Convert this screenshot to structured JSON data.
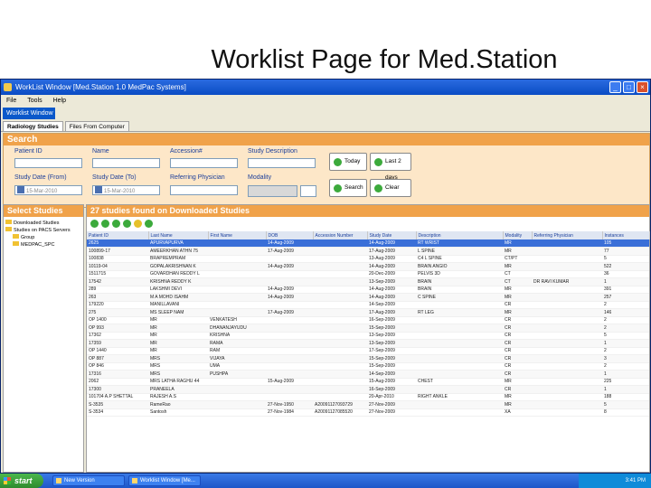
{
  "slide": {
    "title": "Worklist Page for Med.Station"
  },
  "window": {
    "title": "WorkList Window [Med.Station 1.0 MedPac Systems]",
    "menu": [
      "File",
      "Tools",
      "Help"
    ],
    "main_tab": "Worklist Window",
    "subtabs": [
      "Radiology Studies",
      "Files From Computer"
    ]
  },
  "search": {
    "header": "Search",
    "patient_id_label": "Patient ID",
    "name_label": "Name",
    "accession_label": "Accession#",
    "study_desc_label": "Study Description",
    "study_date_from_label": "Study Date (From)",
    "study_date_to_label": "Study Date (To)",
    "ref_physician_label": "Referring Physician",
    "modality_label": "Modality",
    "date_from_value": "15-Mar-2010",
    "date_to_value": "15-Mar-2010",
    "today_label": "Today",
    "last2days_label": "Last 2 days",
    "search_label": "Search",
    "clear_label": "Clear"
  },
  "left": {
    "header": "Select Studies",
    "tree": [
      "Downloaded Studies",
      "Studies on PACS Servers",
      "Group",
      "MEDPAC_SPC"
    ]
  },
  "right": {
    "header": "27 studies found on Downloaded Studies",
    "columns": [
      "Patient ID",
      "Last Name",
      "First Name",
      "DOB",
      "Accession Number",
      "Study Date",
      "Description",
      "Modality",
      "Referring Physician",
      "Instances"
    ],
    "rows": [
      [
        "2625",
        "APURVAPURVA",
        "",
        "14-Aug-2009",
        "",
        "14-Aug-2009",
        "RT WRIST",
        "MR",
        "",
        "105"
      ],
      [
        "100899-17",
        "AMEERKHAN ATHN 75",
        "",
        "17-Aug-2009",
        "",
        "17-Aug-2009",
        "L SPINE",
        "MR",
        "",
        "77"
      ],
      [
        "100838",
        "BRAPREMPRAM",
        "",
        "",
        "",
        "13-Aug-2009",
        "C4 L SPINE",
        "CT/PT",
        "",
        "5"
      ],
      [
        "10119-04",
        "GOPALAKRISHNAN K",
        "",
        "14-Aug-2009",
        "",
        "14-Aug-2009",
        "BRAIN ANGIO",
        "MR",
        "",
        "522"
      ],
      [
        "1511715",
        "GOVARDHAN REDDY L",
        "",
        "",
        "",
        "20-Dec-2009",
        "PELVIS 3D",
        "CT",
        "",
        "36"
      ],
      [
        "17542",
        "KRISHNA REDDY K",
        "",
        "",
        "",
        "13-Sep-2009",
        "BRAIN",
        "CT",
        "DR RAVI KUMAR",
        "1"
      ],
      [
        "289",
        "LAKSHMI DEVI",
        "",
        "14-Aug-2009",
        "",
        "14-Aug-2009",
        "BRAIN",
        "MR",
        "",
        "391"
      ],
      [
        "263",
        "M A MOHD ISAHM",
        "",
        "14-Aug-2009",
        "",
        "14-Aug-2009",
        "C SPINE",
        "MR",
        "",
        "257"
      ],
      [
        "179220",
        "MANILLAVANI",
        "",
        "",
        "",
        "14-Sep-2009",
        "",
        "CR",
        "",
        "2"
      ],
      [
        "275",
        "MS SLEEP NAM",
        "",
        "17-Aug-2009",
        "",
        "17-Aug-2009",
        "RT LEG",
        "MR",
        "",
        "146"
      ],
      [
        "OP 1400",
        "MR",
        "VENKATESH",
        "",
        "",
        "16-Sep-2009",
        "",
        "CR",
        "",
        "2"
      ],
      [
        "OP 993",
        "MR",
        "DHANANJAYUDU",
        "",
        "",
        "15-Sep-2009",
        "",
        "CR",
        "",
        "2"
      ],
      [
        "17362",
        "MR",
        "KRISHNA",
        "",
        "",
        "13-Sep-2009",
        "",
        "CR",
        "",
        "5"
      ],
      [
        "17359",
        "MR",
        "RAMA",
        "",
        "",
        "13-Sep-2009",
        "",
        "CR",
        "",
        "1"
      ],
      [
        "OP 1440",
        "MR",
        "RAM",
        "",
        "",
        "17-Sep-2009",
        "",
        "CR",
        "",
        "2"
      ],
      [
        "OP 887",
        "MRS",
        "VIJAYA",
        "",
        "",
        "15-Sep-2009",
        "",
        "CR",
        "",
        "3"
      ],
      [
        "OP 846",
        "MRS",
        "UMA",
        "",
        "",
        "15-Sep-2009",
        "",
        "CR",
        "",
        "2"
      ],
      [
        "17316",
        "MRS",
        "PUSHPA",
        "",
        "",
        "14-Sep-2009",
        "",
        "CR",
        "",
        "1"
      ],
      [
        "2062",
        "MRS LATHA RAGHU 44",
        "",
        "15-Aug-2009",
        "",
        "15-Aug-2009",
        "CHEST",
        "MR",
        "",
        "225"
      ],
      [
        "17300",
        "PRANEELA",
        "",
        "",
        "",
        "16-Sep-2009",
        "",
        "CR",
        "",
        "1"
      ],
      [
        "101704 A.P SHETTAL",
        "RAJESH A.S",
        "",
        "",
        "",
        "20-Apr-2010",
        "RIGHT ANKLE",
        "MR",
        "",
        "188"
      ],
      [
        "S-3535",
        "RameRao",
        "",
        "27-Nov-1950",
        "A20091127093729",
        "27-Nov-2009",
        "",
        "MR",
        "",
        "5"
      ],
      [
        "S-3534",
        "Santosh",
        "",
        "27-Nov-1984",
        "A20091127085520",
        "27-Nov-2009",
        "",
        "XA",
        "",
        "8"
      ]
    ]
  },
  "taskbar": {
    "start": "start",
    "tasks": [
      "New Version",
      "Worklist Window [Me..."
    ],
    "clock": "3:41 PM"
  }
}
